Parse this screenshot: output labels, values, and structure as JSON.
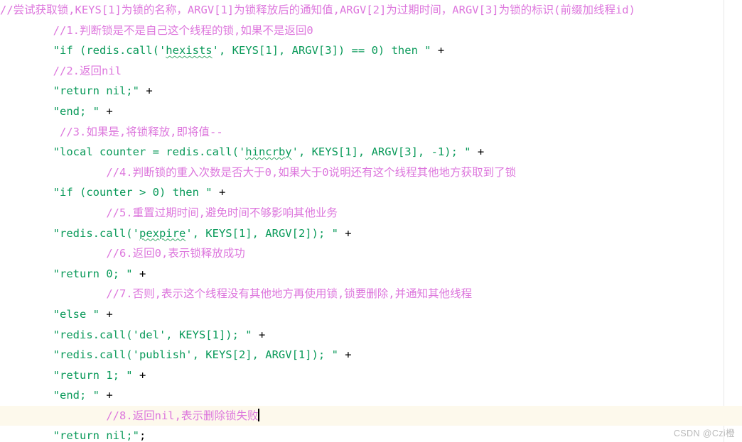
{
  "editor": {
    "background_color": "#ffffff",
    "comment_color": "#dd77dd",
    "string_color": "#0a9a5a",
    "plain_color": "#000000",
    "highlight_color": "#fdf9ec",
    "typo_underline_color": "#3aaa6a",
    "margin_guide_color": "#e8e8e8"
  },
  "watermark": {
    "text": "CSDN @Czi橙"
  },
  "lines": [
    {
      "n": 1,
      "indent": "",
      "type": "comment",
      "text": "//尝试获取锁,KEYS[1]为锁的名称，ARGV[1]为锁释放后的通知值,ARGV[2]为过期时间，ARGV[3]为锁的标识(前缀加线程id)"
    },
    {
      "n": 2,
      "indent": "        ",
      "type": "comment",
      "text": "//1.判断锁是不是自己这个线程的锁,如果不是返回0"
    },
    {
      "n": 3,
      "indent": "        ",
      "type": "code",
      "pre": "\"if (redis.call('",
      "typo": "hexists",
      "post": "', KEYS[1], ARGV[3]) == 0) then \"",
      "op": " +"
    },
    {
      "n": 4,
      "indent": "        ",
      "type": "comment",
      "text": "//2.返回nil"
    },
    {
      "n": 5,
      "indent": "        ",
      "type": "code",
      "pre": "\"return nil;\"",
      "typo": "",
      "post": "",
      "op": " +"
    },
    {
      "n": 6,
      "indent": "        ",
      "type": "code",
      "pre": "\"end; \"",
      "typo": "",
      "post": "",
      "op": " +"
    },
    {
      "n": 7,
      "indent": "         ",
      "type": "comment",
      "text": "//3.如果是,将锁释放,即将值--"
    },
    {
      "n": 8,
      "indent": "        ",
      "type": "code",
      "pre": "\"local counter = redis.call('",
      "typo": "hincrby",
      "post": "', KEYS[1], ARGV[3], -1); \"",
      "op": " +"
    },
    {
      "n": 9,
      "indent": "                ",
      "type": "comment",
      "text": "//4.判断锁的重入次数是否大于0,如果大于0说明还有这个线程其他地方获取到了锁"
    },
    {
      "n": 10,
      "indent": "        ",
      "type": "code",
      "pre": "\"if (counter > 0) then \"",
      "typo": "",
      "post": "",
      "op": " +"
    },
    {
      "n": 11,
      "indent": "                ",
      "type": "comment",
      "text": "//5.重置过期时间,避免时间不够影响其他业务"
    },
    {
      "n": 12,
      "indent": "        ",
      "type": "code",
      "pre": "\"redis.call('",
      "typo": "pexpire",
      "post": "', KEYS[1], ARGV[2]); \"",
      "op": " +"
    },
    {
      "n": 13,
      "indent": "                ",
      "type": "comment",
      "text": "//6.返回0,表示锁释放成功"
    },
    {
      "n": 14,
      "indent": "        ",
      "type": "code",
      "pre": "\"return 0; \"",
      "typo": "",
      "post": "",
      "op": " +"
    },
    {
      "n": 15,
      "indent": "                ",
      "type": "comment",
      "text": "//7.否则,表示这个线程没有其他地方再使用锁,锁要删除,并通知其他线程"
    },
    {
      "n": 16,
      "indent": "        ",
      "type": "code",
      "pre": "\"else \"",
      "typo": "",
      "post": "",
      "op": " +"
    },
    {
      "n": 17,
      "indent": "        ",
      "type": "code",
      "pre": "\"redis.call('del', KEYS[1]); \"",
      "typo": "",
      "post": "",
      "op": " +"
    },
    {
      "n": 18,
      "indent": "        ",
      "type": "code",
      "pre": "\"redis.call('publish', KEYS[2], ARGV[1]); \"",
      "typo": "",
      "post": "",
      "op": " +"
    },
    {
      "n": 19,
      "indent": "        ",
      "type": "code",
      "pre": "\"return 1; \"",
      "typo": "",
      "post": "",
      "op": " +"
    },
    {
      "n": 20,
      "indent": "        ",
      "type": "code",
      "pre": "\"end; \"",
      "typo": "",
      "post": "",
      "op": " +"
    },
    {
      "n": 21,
      "indent": "                ",
      "type": "comment",
      "text": "//8.返回nil,表示删除锁失败",
      "highlighted": true,
      "caret": true
    },
    {
      "n": 22,
      "indent": "        ",
      "type": "code",
      "pre": "\"return nil;\"",
      "typo": "",
      "post": "",
      "op": ";"
    }
  ]
}
